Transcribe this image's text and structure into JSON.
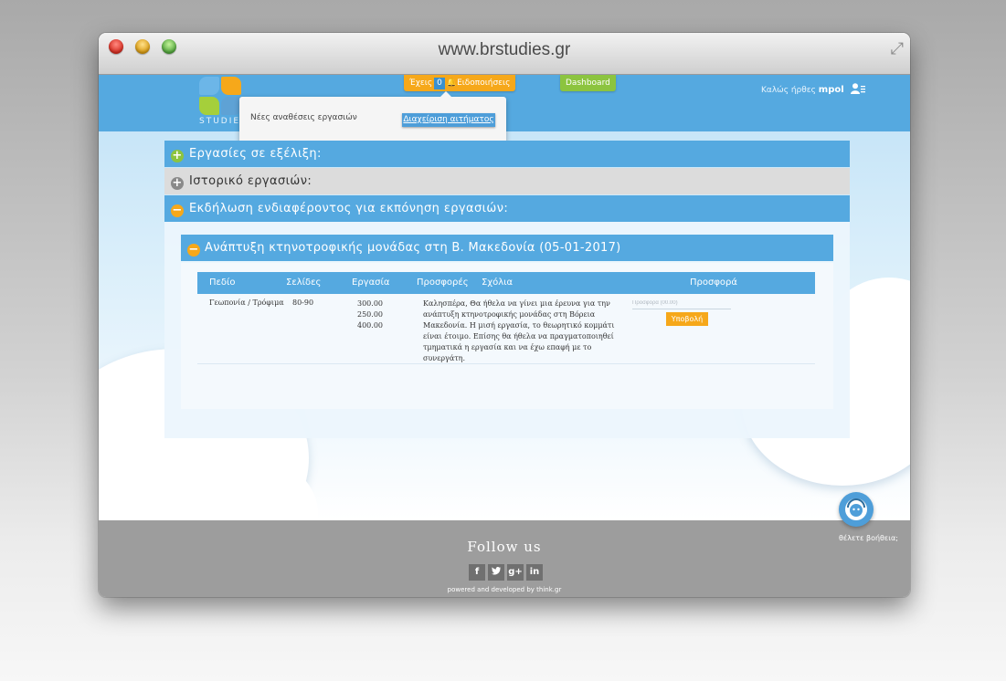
{
  "browser": {
    "url": "www.brstudies.gr"
  },
  "header": {
    "logo_text": "STUDIES",
    "notifications": {
      "prefix": "Έχεις",
      "count": "0",
      "label": "Ειδοποιήσεις"
    },
    "dashboard_label": "Dashboard",
    "welcome_text": "Καλώς ήρθες",
    "username": "mpol"
  },
  "dropdown": {
    "message": "Νέες αναθέσεις εργασιών",
    "manage_button": "Διαχείριση αιτήματος"
  },
  "accordions": [
    {
      "label": "Εργασίες σε εξέλιξη:",
      "state": "collapsed"
    },
    {
      "label": "Ιστορικό εργασιών:",
      "state": "collapsed"
    },
    {
      "label": "Εκδήλωση ενδιαφέροντος για εκπόνηση εργασιών:",
      "state": "expanded"
    }
  ],
  "project": {
    "title": "Ανάπτυξη κτηνοτροφικής μονάδας στη Β. Μακεδονία (05-01-2017)",
    "columns": [
      "Πεδίο",
      "Σελίδες",
      "Εργασία",
      "Προσφορές",
      "Σχόλια",
      "Προσφορά"
    ],
    "row": {
      "field": "Γεωπονία / Τρόφιμα",
      "pages": "80-90",
      "offers": [
        "300.00",
        "250.00",
        "400.00"
      ],
      "comment": "Καλησπέρα, Θα ήθελα να γίνει μια έρευνα για την ανάπτυξη κτηνοτροφικής μονάδας στη Βόρεια Μακεδονία. Η μισή εργασία, το θεωρητικό κομμάτι είναι έτοιμο. Επίσης θα ήθελα να πραγματοποιηθεί τμηματικά η εργασία και να έχω επαφή με το συνεργάτη.",
      "offer_placeholder": "Προσφορά (00.00)",
      "submit_label": "Υποβολή"
    }
  },
  "footer": {
    "follow_label": "Follow us",
    "socials": [
      "f",
      "t",
      "g+",
      "in"
    ],
    "powered_by": "powered and developed by think.gr",
    "help_text": "θέλετε βοήθεια;"
  },
  "colors": {
    "primary_blue": "#55a9e0",
    "orange": "#f6a81a",
    "green": "#8cc43f",
    "footer_gray": "#9d9d9d"
  }
}
